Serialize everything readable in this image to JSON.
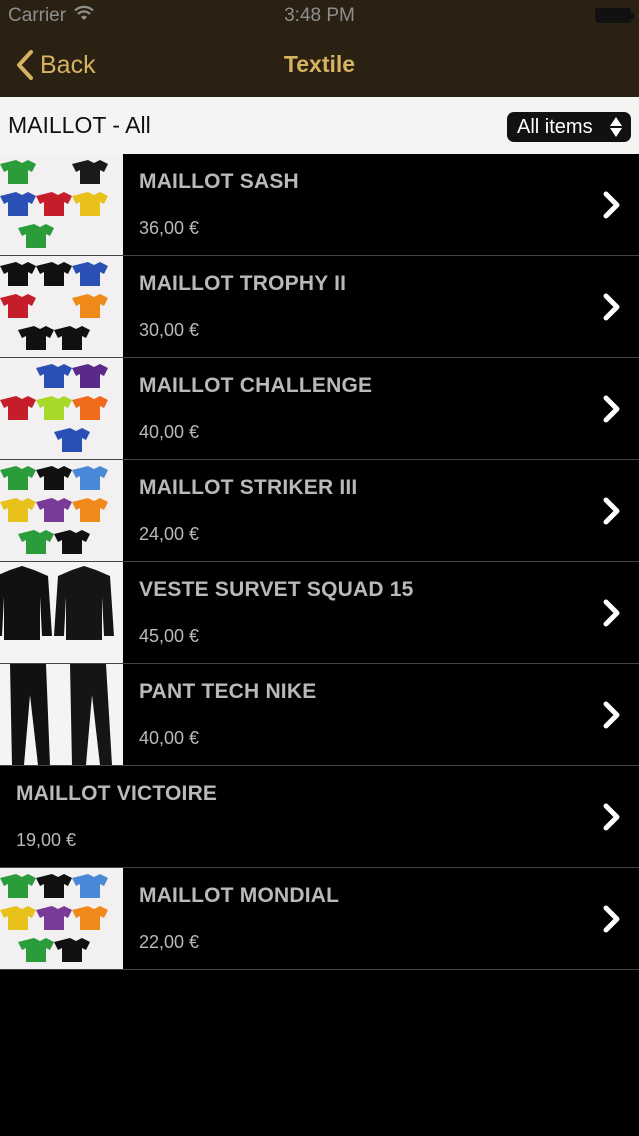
{
  "status": {
    "carrier": "Carrier",
    "time": "3:48 PM"
  },
  "nav": {
    "back_label": "Back",
    "title": "Textile"
  },
  "filter": {
    "title": "MAILLOT - All",
    "button_label": "All items"
  },
  "colors": {
    "accent": "#d7b262",
    "bar": "#2a2112"
  },
  "items": [
    {
      "name": "MAILLOT SASH",
      "price": "36,00 €",
      "thumb": "jerseys"
    },
    {
      "name": "MAILLOT TROPHY II",
      "price": "30,00 €",
      "thumb": "jerseys"
    },
    {
      "name": "MAILLOT CHALLENGE",
      "price": "40,00 €",
      "thumb": "jerseys"
    },
    {
      "name": "MAILLOT STRIKER III",
      "price": "24,00 €",
      "thumb": "jerseys"
    },
    {
      "name": "VESTE SURVET SQUAD 15",
      "price": "45,00 €",
      "thumb": "jacket"
    },
    {
      "name": "PANT TECH NIKE",
      "price": "40,00 €",
      "thumb": "pants"
    },
    {
      "name": "MAILLOT VICTOIRE",
      "price": "19,00 €",
      "thumb": ""
    },
    {
      "name": "MAILLOT MONDIAL",
      "price": "22,00 €",
      "thumb": "jerseys"
    }
  ]
}
